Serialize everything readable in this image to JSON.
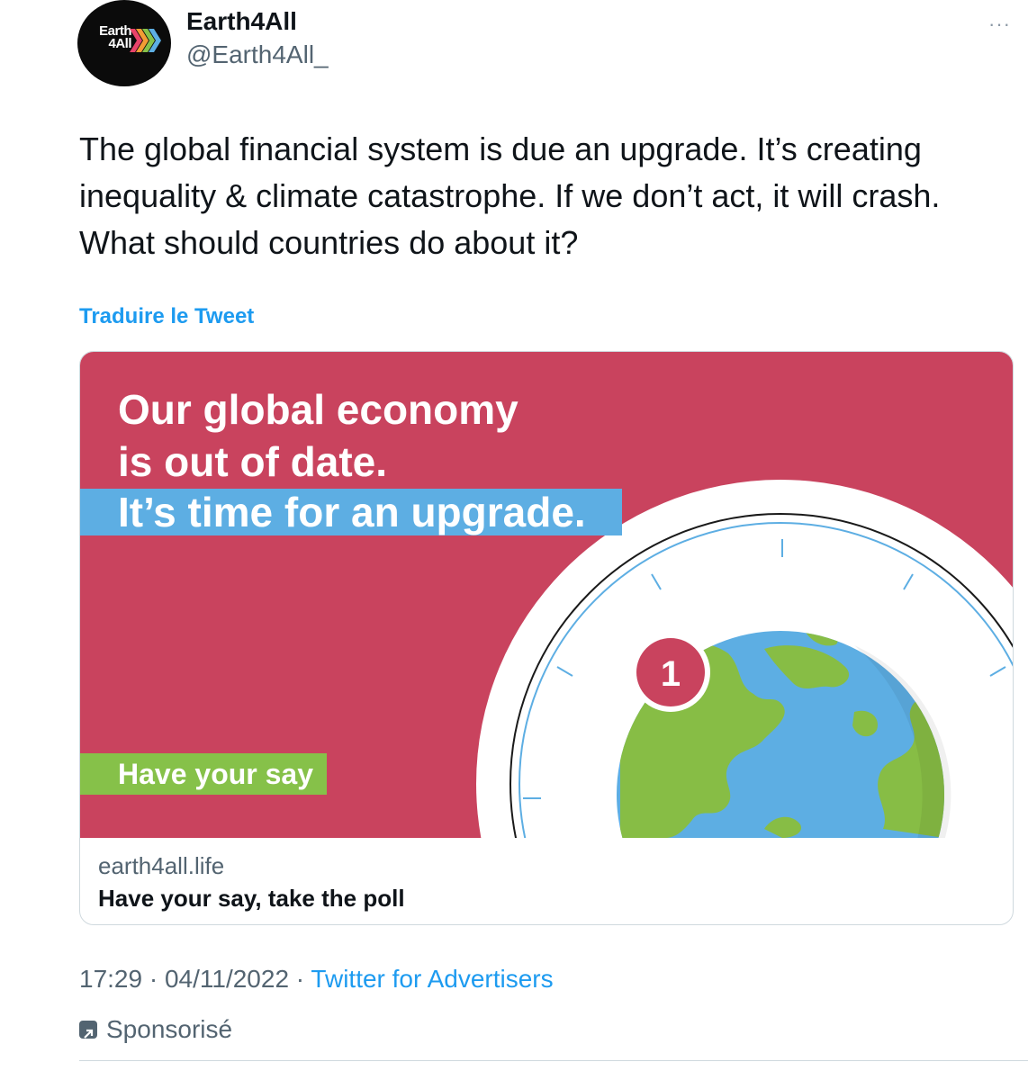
{
  "author": {
    "avatar_text_line1": "Earth",
    "avatar_text_line2": "4All",
    "display_name": "Earth4All",
    "handle": "@Earth4All_"
  },
  "more_label": "···",
  "tweet": {
    "text": "The global financial system is due an upgrade. It’s creating inequality & climate catastrophe. If we don’t act, it will crash. What should countries do about it?",
    "translate_label": "Traduire le Tweet"
  },
  "card": {
    "headline_line1": "Our global economy",
    "headline_line2": "is out of date.",
    "headline_highlight": "It’s time for an upgrade.",
    "cta_label": "Have your say",
    "badge_number": "1",
    "domain": "earth4all.life",
    "title": "Have your say, take the poll"
  },
  "meta": {
    "time": "17:29",
    "date": "04/11/2022",
    "separator": " · ",
    "source": "Twitter for Advertisers",
    "sponsored_label": "Sponsorisé"
  },
  "colors": {
    "card_bg": "#c9435e",
    "highlight_blue": "#5daee3",
    "cta_green": "#86c149",
    "globe_ocean": "#5daee3",
    "globe_land": "#87bd45",
    "link_blue": "#1d9bf0"
  }
}
